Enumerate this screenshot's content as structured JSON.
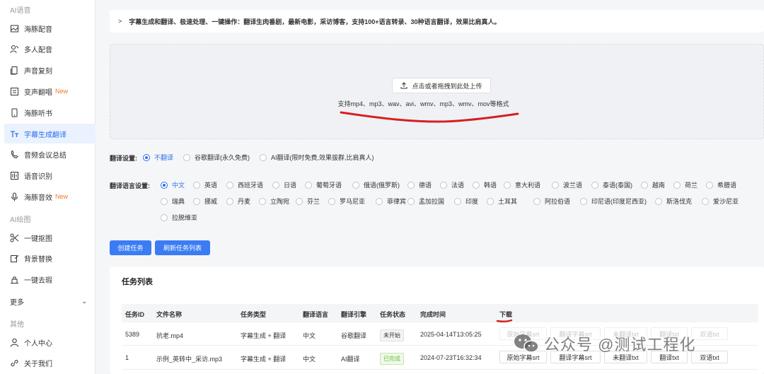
{
  "sidebar": {
    "sec_ai_voice": "AI语音",
    "items_voice": [
      {
        "label": "海豚配音",
        "icon": "image-frame-icon"
      },
      {
        "label": "多人配音",
        "icon": "users-icon"
      },
      {
        "label": "声音复刻",
        "icon": "copy-icon"
      },
      {
        "label": "变声翻唱",
        "icon": "voice-change-icon",
        "badge": "New"
      },
      {
        "label": "海豚听书",
        "icon": "phone-icon"
      },
      {
        "label": "字幕生成翻译",
        "icon": "text-icon"
      },
      {
        "label": "音频会议总结",
        "icon": "phone-call-icon"
      },
      {
        "label": "语音识别",
        "icon": "recognize-icon"
      },
      {
        "label": "海豚音效",
        "icon": "mic-icon",
        "badge": "New"
      }
    ],
    "sec_ai_draw": "AI绘图",
    "items_draw": [
      {
        "label": "一键抠图",
        "icon": "scissors-icon"
      },
      {
        "label": "背景替换",
        "icon": "edit-image-icon"
      },
      {
        "label": "一键去瑕",
        "icon": "eraser-icon"
      }
    ],
    "more": "更多",
    "sec_other": "其他",
    "items_other": [
      {
        "label": "个人中心",
        "icon": "user-icon"
      },
      {
        "label": "关于我们",
        "icon": "link-icon"
      }
    ]
  },
  "info": "字幕生成和翻译、极速处理、一键操作：翻译生肉番剧，最新电影，采访博客，支持100+语言转录、30种语言翻译，效果比肩真人。",
  "upload": {
    "button": "点击或者拖拽到此处上传",
    "hint": "支持mp4、mp3、wav、avi、wmv、mp3、wmv、mov等格式"
  },
  "translate_setting": {
    "label": "翻译设置:",
    "options": [
      "不翻译",
      "谷歌翻译(永久免费)",
      "AI翻译(限时免费,效果拔群,比肩真人)"
    ],
    "selected": 0
  },
  "language_setting": {
    "label": "翻译语言设置:",
    "row1": [
      "中文",
      "英语",
      "西班牙语",
      "日语",
      "葡萄牙语",
      "俄语(俄罗斯)",
      "德语",
      "法语",
      "韩语",
      "意大利语",
      "波兰语",
      "泰语(泰国)",
      "越南",
      "荷兰",
      "希腊语"
    ],
    "row2": [
      "瑞典",
      "挪威",
      "丹麦",
      "立陶宛",
      "芬兰",
      "罗马尼亚",
      "菲律宾",
      "孟加拉国",
      "印度",
      "土耳其",
      "阿拉伯语",
      "印尼语(印度尼西亚)",
      "斯洛伐克",
      "爱沙尼亚"
    ],
    "row3": [
      "拉脱维亚"
    ],
    "selected": "中文"
  },
  "buttons": {
    "create": "创建任务",
    "refresh": "刷新任务列表"
  },
  "tasks": {
    "title": "任务列表",
    "headers": [
      "任务ID",
      "文件名称",
      "任务类型",
      "翻译语言",
      "翻译引擎",
      "任务状态",
      "完成时间",
      "下载"
    ],
    "rows": [
      {
        "id": "5389",
        "name": "抗老.mp4",
        "type": "字幕生成 + 翻译",
        "lang": "中文",
        "engine": "谷歌翻译",
        "status": "未开始",
        "time": "2025-04-14T13:05:25",
        "downloads": [
          "原始字幕srt",
          "翻译字幕srt",
          "未翻译txt",
          "翻译txt",
          "双语txt"
        ]
      },
      {
        "id": "1",
        "name": "示例_英转中_采访.mp3",
        "type": "字幕生成 + 翻译",
        "lang": "中文",
        "engine": "AI翻译",
        "status": "已完成",
        "time": "2024-07-23T16:32:34",
        "downloads": [
          "原始字幕srt",
          "翻译字幕srt",
          "未翻译txt",
          "翻译txt",
          "双语txt"
        ]
      }
    ]
  },
  "watermark": "公众号 @测试工程化",
  "colors": {
    "accent": "#3b7cf4",
    "annotation": "#d42020",
    "new_badge": "#f07a2b"
  }
}
